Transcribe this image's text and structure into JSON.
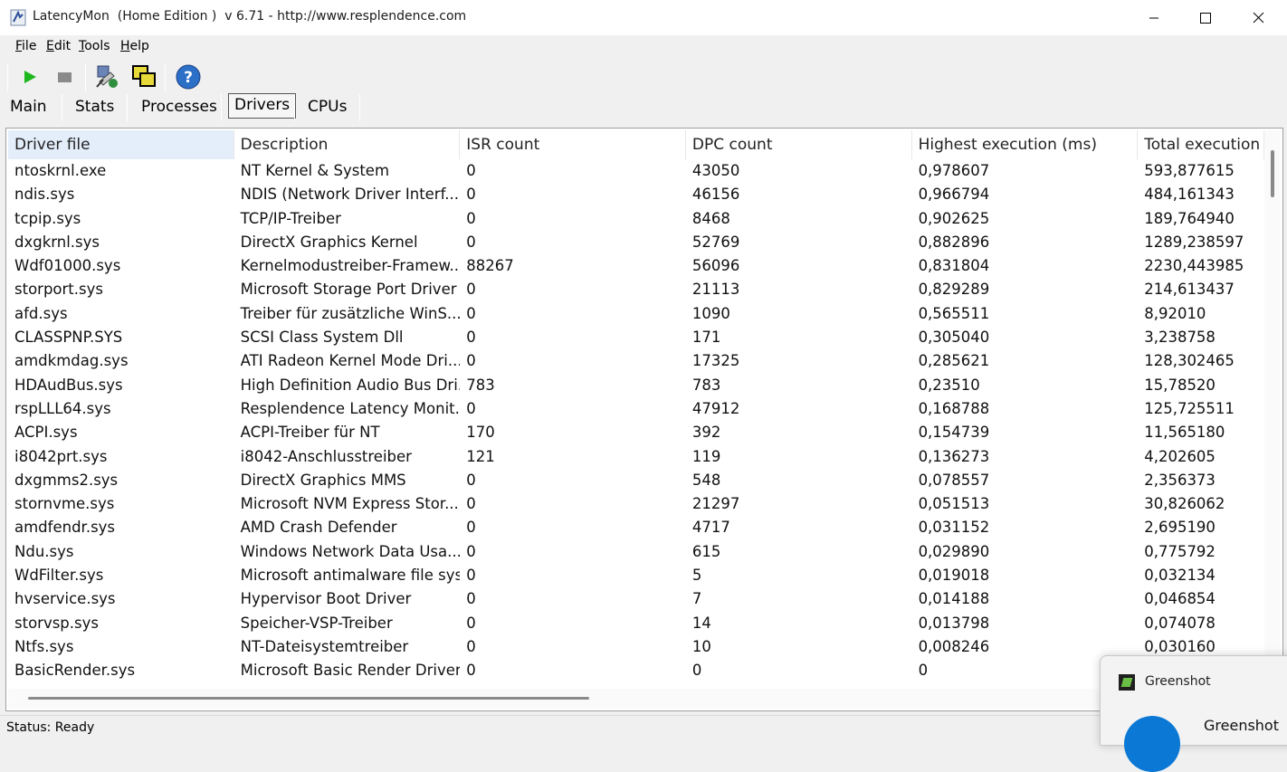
{
  "window": {
    "title": "LatencyMon  (Home Edition )  v 6.71 - http://www.resplendence.com"
  },
  "menu": [
    {
      "key": "F",
      "rest": "ile"
    },
    {
      "key": "E",
      "rest": "dit"
    },
    {
      "key": "T",
      "rest": "ools"
    },
    {
      "key": "H",
      "rest": "elp"
    }
  ],
  "toolbar": {
    "icons": [
      "play-icon",
      "stop-icon",
      "wizard-icon",
      "windows-icon",
      "help-icon"
    ],
    "colors": {
      "play": "#1db81d",
      "stop": "#8a8a8a",
      "help": "#2b6fc7"
    }
  },
  "tabs": [
    {
      "label": "Main",
      "active": false
    },
    {
      "label": "Stats",
      "active": false
    },
    {
      "label": "Processes",
      "active": false
    },
    {
      "label": "Drivers",
      "active": true
    },
    {
      "label": "CPUs",
      "active": false
    }
  ],
  "table": {
    "columns": [
      "Driver file",
      "Description",
      "ISR count",
      "DPC count",
      "Highest execution (ms)",
      "Total execution ("
    ],
    "rows": [
      [
        "ntoskrnl.exe",
        "NT Kernel & System",
        "0",
        "43050",
        "0,978607",
        "593,877615"
      ],
      [
        "ndis.sys",
        "NDIS (Network Driver Interf...",
        "0",
        "46156",
        "0,966794",
        "484,161343"
      ],
      [
        "tcpip.sys",
        "TCP/IP-Treiber",
        "0",
        "8468",
        "0,902625",
        "189,764940"
      ],
      [
        "dxgkrnl.sys",
        "DirectX Graphics Kernel",
        "0",
        "52769",
        "0,882896",
        "1289,238597"
      ],
      [
        "Wdf01000.sys",
        "Kernelmodustreiber-Framew...",
        "88267",
        "56096",
        "0,831804",
        "2230,443985"
      ],
      [
        "storport.sys",
        "Microsoft Storage Port Driver",
        "0",
        "21113",
        "0,829289",
        "214,613437"
      ],
      [
        "afd.sys",
        "Treiber für zusätzliche WinS...",
        "0",
        "1090",
        "0,565511",
        "8,92010"
      ],
      [
        "CLASSPNP.SYS",
        "SCSI Class System Dll",
        "0",
        "171",
        "0,305040",
        "3,238758"
      ],
      [
        "amdkmdag.sys",
        "ATI Radeon Kernel Mode Dri...",
        "0",
        "17325",
        "0,285621",
        "128,302465"
      ],
      [
        "HDAudBus.sys",
        "High Definition Audio Bus Dri...",
        "783",
        "783",
        "0,23510",
        "15,78520"
      ],
      [
        "rspLLL64.sys",
        "Resplendence Latency Monit...",
        "0",
        "47912",
        "0,168788",
        "125,725511"
      ],
      [
        "ACPI.sys",
        "ACPI-Treiber für NT",
        "170",
        "392",
        "0,154739",
        "11,565180"
      ],
      [
        "i8042prt.sys",
        "i8042-Anschlusstreiber",
        "121",
        "119",
        "0,136273",
        "4,202605"
      ],
      [
        "dxgmms2.sys",
        "DirectX Graphics MMS",
        "0",
        "548",
        "0,078557",
        "2,356373"
      ],
      [
        "stornvme.sys",
        "Microsoft NVM Express Stor...",
        "0",
        "21297",
        "0,051513",
        "30,826062"
      ],
      [
        "amdfendr.sys",
        "AMD Crash Defender",
        "0",
        "4717",
        "0,031152",
        "2,695190"
      ],
      [
        "Ndu.sys",
        "Windows Network Data Usa...",
        "0",
        "615",
        "0,029890",
        "0,775792"
      ],
      [
        "WdFilter.sys",
        "Microsoft antimalware file sys...",
        "0",
        "5",
        "0,019018",
        "0,032134"
      ],
      [
        "hvservice.sys",
        "Hypervisor Boot Driver",
        "0",
        "7",
        "0,014188",
        "0,046854"
      ],
      [
        "storvsp.sys",
        "Speicher-VSP-Treiber",
        "0",
        "14",
        "0,013798",
        "0,074078"
      ],
      [
        "Ntfs.sys",
        "NT-Dateisystemtreiber",
        "0",
        "10",
        "0,008246",
        "0,030160"
      ],
      [
        "BasicRender.sys",
        "Microsoft Basic Render Driver",
        "0",
        "0",
        "0",
        ""
      ]
    ]
  },
  "status": "Status: Ready",
  "notification": {
    "app": "Greenshot",
    "title": "Greenshot"
  }
}
